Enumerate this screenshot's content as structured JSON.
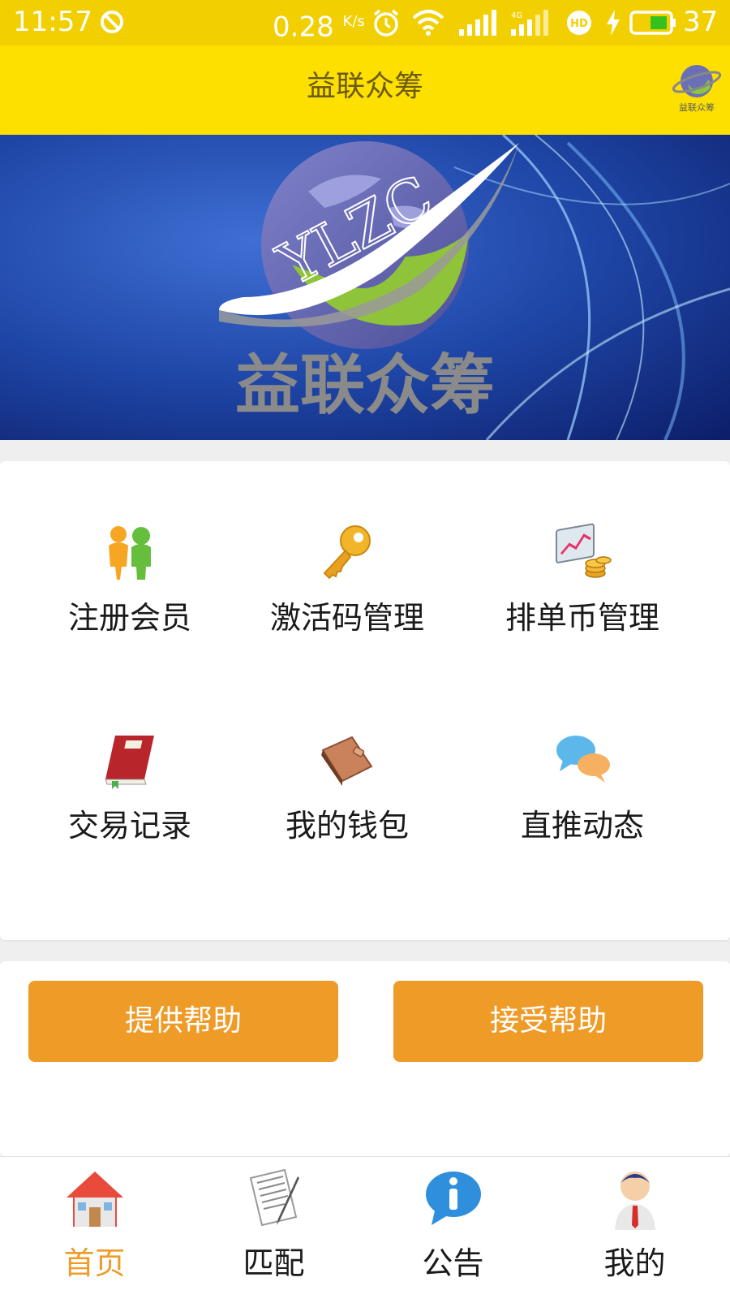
{
  "status_bar": {
    "time": "11:57",
    "speed": "0.28",
    "speed_unit": "K/s",
    "network_type": "4G",
    "battery": "37"
  },
  "app_bar": {
    "title": "益联众筹",
    "logo_text": "益联众筹"
  },
  "banner": {
    "globe_text": "YLZC",
    "title": "益联众筹"
  },
  "menu": {
    "items": [
      {
        "label": "注册会员",
        "icon": "users-icon"
      },
      {
        "label": "激活码管理",
        "icon": "key-icon"
      },
      {
        "label": "排单币管理",
        "icon": "chart-coins-icon"
      },
      {
        "label": "交易记录",
        "icon": "book-icon"
      },
      {
        "label": "我的钱包",
        "icon": "wallet-icon"
      },
      {
        "label": "直推动态",
        "icon": "chat-bubbles-icon"
      }
    ]
  },
  "actions": {
    "provide_help": "提供帮助",
    "accept_help": "接受帮助"
  },
  "bottom_nav": {
    "items": [
      {
        "label": "首页",
        "icon": "home-icon",
        "active": true
      },
      {
        "label": "匹配",
        "icon": "document-icon",
        "active": false
      },
      {
        "label": "公告",
        "icon": "info-icon",
        "active": false
      },
      {
        "label": "我的",
        "icon": "profile-icon",
        "active": false
      }
    ]
  },
  "colors": {
    "status_bar": "#f2cf00",
    "app_bar": "#fddf00",
    "accent": "#ee9b28",
    "app_title": "#6b5a10"
  }
}
